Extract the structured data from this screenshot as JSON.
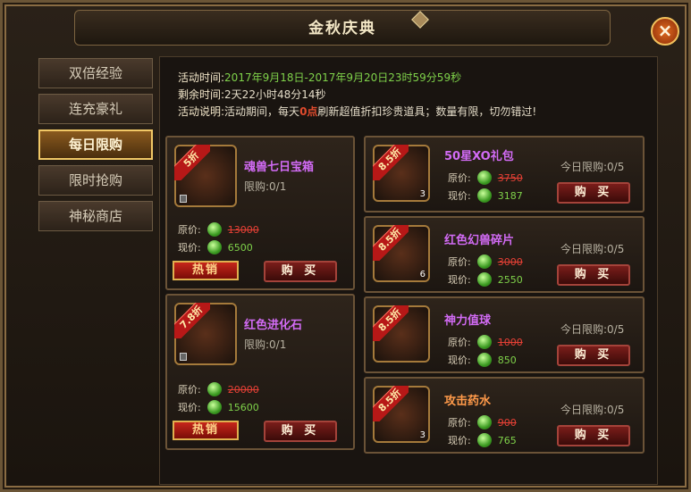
{
  "title": "金秋庆典",
  "sidebar": [
    {
      "label": "双倍经验"
    },
    {
      "label": "连充豪礼"
    },
    {
      "label": "每日限购",
      "active": true
    },
    {
      "label": "限时抢购"
    },
    {
      "label": "神秘商店"
    }
  ],
  "info": {
    "time_label": "活动时间:",
    "time_value": "2017年9月18日-2017年9月20日23时59分59秒",
    "remain_label": "剩余时间:",
    "remain_value": "2天22小时48分14秒",
    "desc_label": "活动说明:",
    "desc_prefix": "活动期间，每天",
    "desc_highlight": "0点",
    "desc_suffix": "刷新超值折扣珍贵道具；数量有限，切勿错过!"
  },
  "labels": {
    "original_price": "原价:",
    "current_price": "现价:",
    "buy": "购 买",
    "hot": "热销"
  },
  "left_items": [
    {
      "discount": "5折",
      "name": "魂兽七日宝箱",
      "limit": "限购:0/1",
      "original": "13000",
      "current": "6500"
    },
    {
      "discount": "7.8折",
      "name": "红色进化石",
      "limit": "限购:0/1",
      "original": "20000",
      "current": "15600"
    }
  ],
  "right_items": [
    {
      "discount": "8.5折",
      "name": "50星XO礼包",
      "count": "3",
      "daily": "今日限购:0/5",
      "original": "3750",
      "current": "3187"
    },
    {
      "discount": "8.5折",
      "name": "红色幻兽碎片",
      "count": "6",
      "daily": "今日限购:0/5",
      "original": "3000",
      "current": "2550"
    },
    {
      "discount": "8.5折",
      "name": "神力值球",
      "count": "",
      "daily": "今日限购:0/5",
      "original": "1000",
      "current": "850"
    },
    {
      "discount": "8.5折",
      "name": "攻击药水",
      "count": "3",
      "daily": "今日限购:0/5",
      "original": "900",
      "current": "765"
    }
  ]
}
